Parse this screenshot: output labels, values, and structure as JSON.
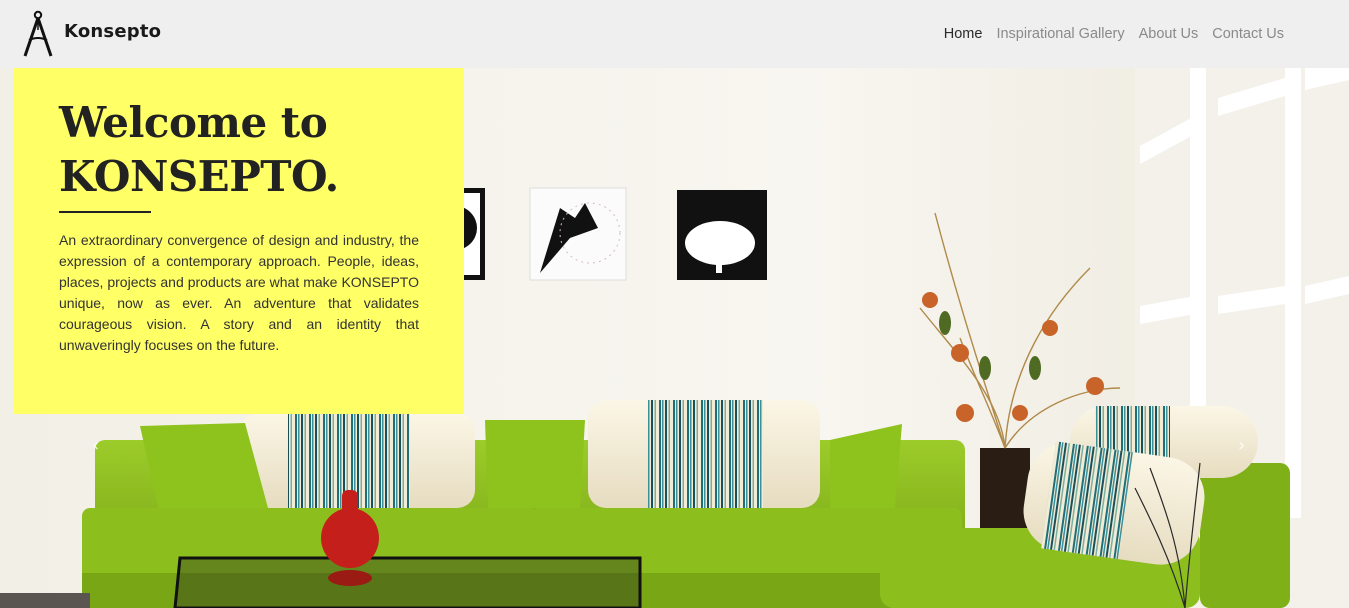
{
  "brand": {
    "name": "Konsepto",
    "logo_icon": "drafting-compass-icon"
  },
  "nav": {
    "items": [
      {
        "label": "Home",
        "active": true
      },
      {
        "label": "Inspirational Gallery",
        "active": false
      },
      {
        "label": "About Us",
        "active": false
      },
      {
        "label": "Contact Us",
        "active": false
      }
    ]
  },
  "hero": {
    "heading_line1": "Welcome to",
    "heading_line2": "KONSEPTO.",
    "description": "An extraordinary convergence of design and industry, the expression of a contemporary approach. People, ideas, places, projects and products are what make KONSEPTO unique, now as ever. An adventure that validates courageous vision. A story and an identity that unwaveringly focuses on the future.",
    "prev_icon": "chevron-left-icon",
    "next_icon": "chevron-right-icon",
    "prev_glyph": "‹",
    "next_glyph": "›"
  },
  "colors": {
    "card_bg": "#ffff66",
    "header_bg": "#efefef",
    "sofa_green": "#8cbf1e"
  }
}
